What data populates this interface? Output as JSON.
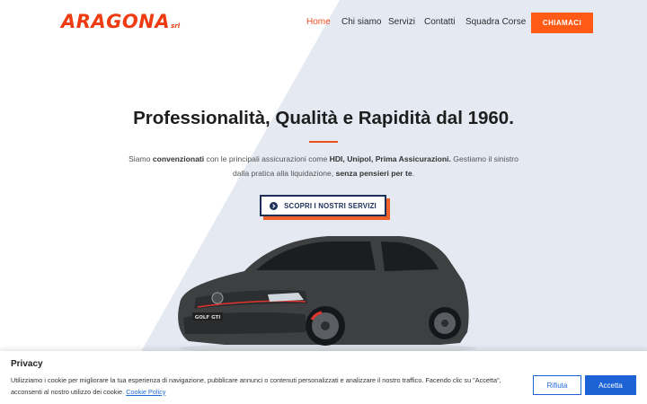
{
  "brand": {
    "name": "ARAGONA",
    "suffix": "srl"
  },
  "nav": {
    "items": [
      {
        "label": "Home",
        "active": true
      },
      {
        "label": "Chi siamo"
      },
      {
        "label": "Servizi"
      },
      {
        "label": "Contatti"
      },
      {
        "label": "Squadra Corse"
      }
    ],
    "cta_label": "CHIAMACI"
  },
  "hero": {
    "title": "Professionalità, Qualità e Rapidità dal 1960.",
    "desc": {
      "p1": "Siamo ",
      "b1": "convenzionati",
      "p2": " con le principali assicurazioni come ",
      "b2": "HDI, Unipol, Prima Assicurazioni.",
      "p3": " Gestiamo il sinistro dalla pratica alla liquidazione, ",
      "b3": "senza pensieri per te",
      "p4": "."
    },
    "cta_label": "SCOPRI I NOSTRI SERVIZI",
    "car_plate": "GOLF GTI"
  },
  "privacy": {
    "title": "Privacy",
    "text": "Utilizziamo i cookie per migliorare la tua esperienza di navigazione, pubblicare annunci o contenuti personalizzati e analizzare il nostro traffico. Facendo clic su \"Accetta\", acconsenti al nostro utilizzo dei cookie.",
    "link": "Cookie Policy",
    "reject_label": "Rifiuta",
    "accept_label": "Accetta"
  },
  "colors": {
    "accent": "#ff5a16",
    "navy": "#1c2f58",
    "link": "#1e63d6",
    "background_tint": "#e5e9f2"
  },
  "icons": {
    "services_button": "arrow-circle-right-icon"
  }
}
